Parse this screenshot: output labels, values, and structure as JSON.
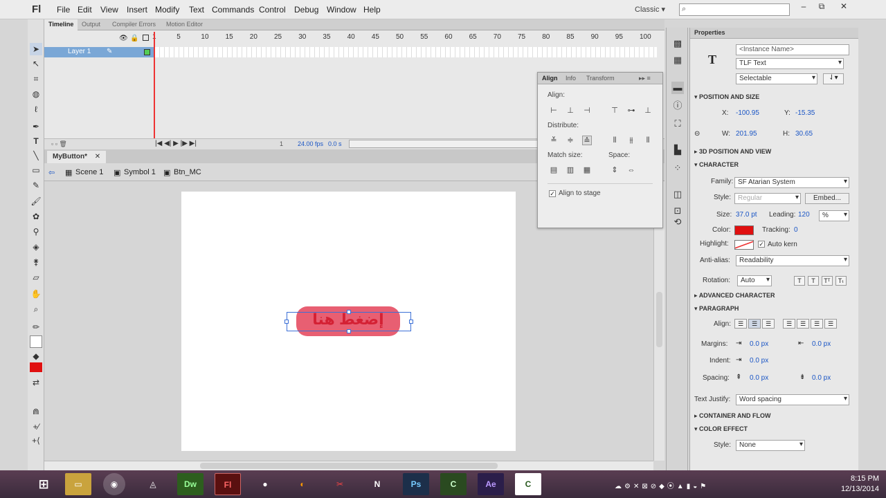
{
  "menubar": {
    "logo": "Fl",
    "items": [
      "File",
      "Edit",
      "View",
      "Insert",
      "Modify",
      "Text",
      "Commands",
      "Control",
      "Debug",
      "Window",
      "Help"
    ],
    "workspace": "Classic",
    "window_buttons": [
      "–",
      "⧉",
      "✕"
    ]
  },
  "timeline": {
    "tabs": [
      "Timeline",
      "Output",
      "Compiler Errors",
      "Motion Editor"
    ],
    "ruler": [
      "1",
      "5",
      "10",
      "15",
      "20",
      "25",
      "30",
      "35",
      "40",
      "45",
      "50",
      "55",
      "60",
      "65",
      "70",
      "75",
      "80",
      "85",
      "90",
      "95",
      "100"
    ],
    "layer_name": "Layer 1",
    "fps": "24.00 fps",
    "time": "0.0 s",
    "frame": "1"
  },
  "document": {
    "tab": "MyButton*",
    "crumbs": [
      "Scene 1",
      "Symbol 1",
      "Btn_MC"
    ],
    "button_text": "إضغط هنا"
  },
  "align_panel": {
    "tabs": [
      "Align",
      "Info",
      "Transform"
    ],
    "align_label": "Align:",
    "distribute_label": "Distribute:",
    "match_label": "Match size:",
    "space_label": "Space:",
    "stage_label": "Align to stage"
  },
  "properties": {
    "title": "Properties",
    "instance_name": "<Instance Name>",
    "text_type": "TLF Text",
    "selectable": "Selectable",
    "position_section": "POSITION AND SIZE",
    "x_label": "X:",
    "x": "-100.95",
    "y_label": "Y:",
    "y": "-15.35",
    "w_label": "W:",
    "w": "201.95",
    "h_label": "H:",
    "h": "30.65",
    "pos3d_section": "3D POSITION AND VIEW",
    "character_section": "CHARACTER",
    "family_label": "Family:",
    "family": "SF Atarian System",
    "style_label": "Style:",
    "style": "Regular",
    "embed": "Embed...",
    "size_label": "Size:",
    "size": "37.0 pt",
    "leading_label": "Leading:",
    "leading": "120",
    "leading_unit": "%",
    "color_label": "Color:",
    "color": "#e01010",
    "tracking_label": "Tracking:",
    "tracking": "0",
    "highlight_label": "Highlight:",
    "autokern": "Auto kern",
    "antialias_label": "Anti-alias:",
    "antialias": "Readability",
    "rotation_label": "Rotation:",
    "rotation": "Auto",
    "advanced_section": "ADVANCED CHARACTER",
    "paragraph_section": "PARAGRAPH",
    "align_label": "Align:",
    "margins_label": "Margins:",
    "margin_l": "0.0 px",
    "margin_r": "0.0 px",
    "indent_label": "Indent:",
    "indent": "0.0 px",
    "spacing_label": "Spacing:",
    "spacing_b": "0.0 px",
    "spacing_a": "0.0 px",
    "justify_label": "Text Justify:",
    "justify": "Word spacing",
    "container_section": "CONTAINER AND FLOW",
    "color_effect_section": "COLOR EFFECT",
    "ce_style_label": "Style:",
    "ce_style": "None"
  },
  "taskbar": {
    "apps": [
      "Dw",
      "Fl",
      "Ps",
      "Ae"
    ],
    "time": "8:15 PM",
    "date": "12/13/2014"
  }
}
